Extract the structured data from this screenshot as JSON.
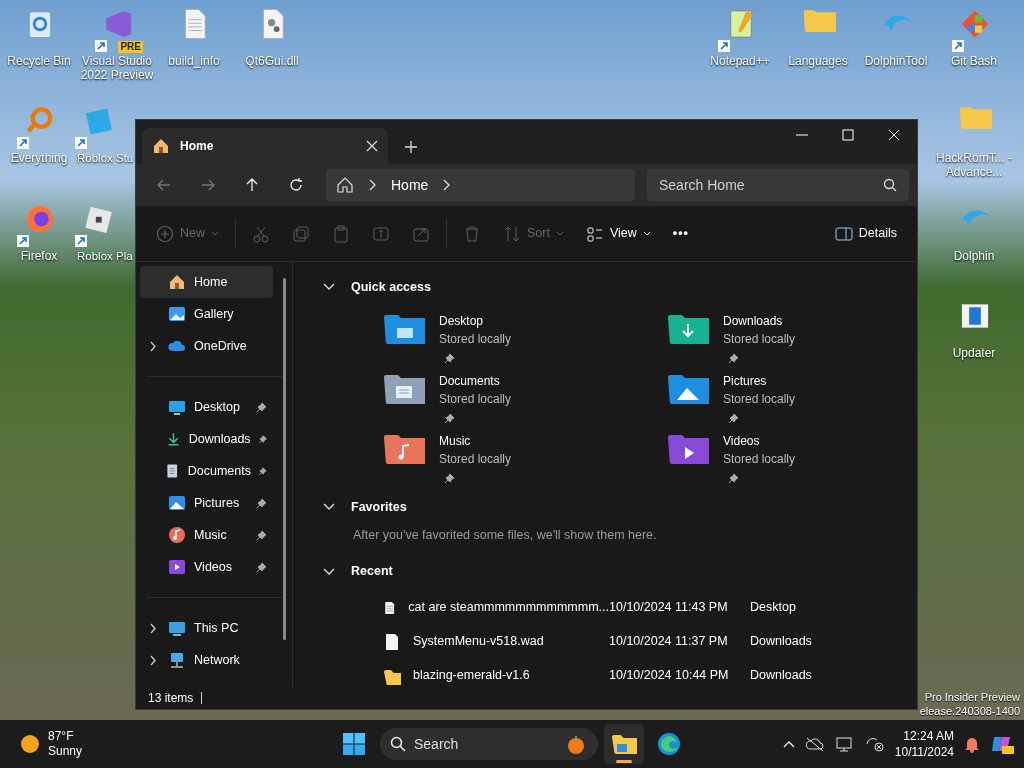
{
  "desktop_icons": [
    {
      "label": "Recycle Bin",
      "kind": "recycle"
    },
    {
      "label": "Visual Studio 2022 Preview",
      "kind": "vs",
      "shortcut": true,
      "badge": "PRE"
    },
    {
      "label": "build_info",
      "kind": "textfile"
    },
    {
      "label": "Qt6Gui.dll",
      "kind": "dll"
    },
    {
      "label": "Everything",
      "kind": "everything",
      "shortcut": true
    },
    {
      "label": "Roblox Stu",
      "kind": "robloxstudio",
      "shortcut": true
    },
    {
      "label": "Firefox",
      "kind": "firefox",
      "shortcut": true
    },
    {
      "label": "Roblox Pla",
      "kind": "roblox",
      "shortcut": true
    },
    {
      "label": "Notepad++",
      "kind": "notepad",
      "shortcut": true
    },
    {
      "label": "Languages",
      "kind": "folder"
    },
    {
      "label": "DolphinTool",
      "kind": "dolphin"
    },
    {
      "label": "Git Bash",
      "kind": "git",
      "shortcut": true
    },
    {
      "label": "HackRomT... - Advance...",
      "kind": "folder"
    },
    {
      "label": "Dolphin",
      "kind": "dolphin"
    },
    {
      "label": "Updater",
      "kind": "updater"
    }
  ],
  "watermark": [
    "Pro Insider Preview",
    "elease.240308-1400"
  ],
  "window": {
    "tabs": [
      {
        "label": "Home",
        "selected": true
      }
    ],
    "breadcrumb": [
      "Home"
    ],
    "search": {
      "placeholder": "Search Home"
    },
    "toolbar": [
      {
        "kind": "new",
        "label": "New",
        "disabled": true
      },
      {
        "kind": "cut",
        "disabled": true
      },
      {
        "kind": "copy",
        "disabled": true
      },
      {
        "kind": "paste",
        "disabled": true
      },
      {
        "kind": "rename",
        "disabled": true
      },
      {
        "kind": "share",
        "disabled": true
      },
      {
        "kind": "delete",
        "disabled": true
      },
      {
        "kind": "sort",
        "label": "Sort",
        "disabled": true
      },
      {
        "kind": "view",
        "label": "View",
        "disabled": false
      },
      {
        "kind": "more",
        "label": "•••",
        "disabled": false
      }
    ],
    "details_button": "Details",
    "sidebar": [
      {
        "label": "Home",
        "kind": "home",
        "selected": true,
        "pinned": false,
        "group_start": false
      },
      {
        "label": "Gallery",
        "kind": "gallery",
        "selected": false,
        "pinned": false,
        "group_start": false
      },
      {
        "label": "OneDrive",
        "kind": "cloud",
        "selected": false,
        "pinned": false,
        "expanded": false,
        "group_start": false
      },
      {
        "label": "Desktop",
        "kind": "desktop",
        "selected": false,
        "pinned": true,
        "group_start": true
      },
      {
        "label": "Downloads",
        "kind": "downloads",
        "selected": false,
        "pinned": true,
        "group_start": false
      },
      {
        "label": "Documents",
        "kind": "documents",
        "selected": false,
        "pinned": true,
        "group_start": false
      },
      {
        "label": "Pictures",
        "kind": "pictures",
        "selected": false,
        "pinned": true,
        "group_start": false
      },
      {
        "label": "Music",
        "kind": "music",
        "selected": false,
        "pinned": true,
        "group_start": false
      },
      {
        "label": "Videos",
        "kind": "videos",
        "selected": false,
        "pinned": true,
        "group_start": false
      },
      {
        "label": "This PC",
        "kind": "pc",
        "selected": false,
        "pinned": false,
        "expanded": false,
        "group_start": true
      },
      {
        "label": "Network",
        "kind": "network",
        "selected": false,
        "pinned": false,
        "expanded": false,
        "group_start": false
      }
    ],
    "quick_access": {
      "title": "Quick access",
      "expanded": true,
      "items": [
        {
          "name": "Desktop",
          "status": "Stored locally",
          "kind": "desktop",
          "pinned": true
        },
        {
          "name": "Downloads",
          "status": "Stored locally",
          "kind": "downloads",
          "pinned": true
        },
        {
          "name": "Documents",
          "status": "Stored locally",
          "kind": "documents",
          "pinned": true
        },
        {
          "name": "Pictures",
          "status": "Stored locally",
          "kind": "pictures",
          "pinned": true
        },
        {
          "name": "Music",
          "status": "Stored locally",
          "kind": "music",
          "pinned": true
        },
        {
          "name": "Videos",
          "status": "Stored locally",
          "kind": "videos",
          "pinned": true
        }
      ]
    },
    "favorites": {
      "title": "Favorites",
      "expanded": true,
      "message": "After you've favorited some files, we'll show them here."
    },
    "recent": {
      "title": "Recent",
      "expanded": true,
      "rows": [
        {
          "name": "cat are steammmmmmmmmmmm...",
          "date": "10/10/2024 11:43 PM",
          "location": "Desktop",
          "kind": "textfile"
        },
        {
          "name": "SystemMenu-v518.wad",
          "date": "10/10/2024 11:37 PM",
          "location": "Downloads",
          "kind": "file"
        },
        {
          "name": "blazing-emerald-v1.6",
          "date": "10/10/2024 10:44 PM",
          "location": "Downloads",
          "kind": "folder"
        }
      ]
    },
    "status_bar": "13 items"
  },
  "taskbar": {
    "weather": {
      "temp": "87°F",
      "condition": "Sunny"
    },
    "search": "Search",
    "apps": [
      {
        "kind": "explorer",
        "active": true
      },
      {
        "kind": "edge",
        "active": false
      }
    ],
    "clock": {
      "time": "12:24 AM",
      "date": "10/11/2024"
    }
  }
}
